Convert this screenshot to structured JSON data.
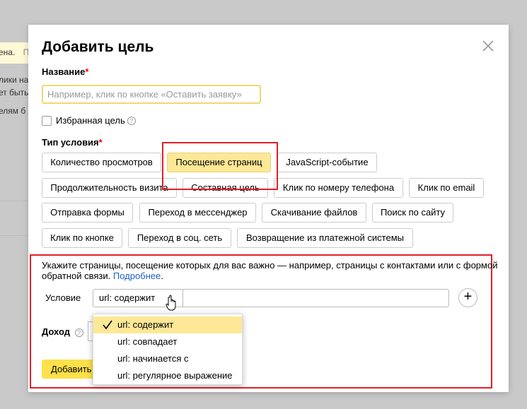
{
  "background": {
    "line1a": "ена.",
    "line1b": "П",
    "line2": "лики на",
    "line3": "ет быть",
    "line4": "елям б"
  },
  "modal": {
    "title": "Добавить цель",
    "name_label": "Название",
    "required_mark": "*",
    "name_placeholder": "Например, клик по кнопке «Оставить заявку»",
    "favorite_label": "Избранная цель",
    "help_symbol": "?",
    "condition_type_label": "Тип условия",
    "condition_types": [
      "Количество просмотров",
      "Посещение страниц",
      "JavaScript-событие",
      "Продолжительность визита",
      "Составная цель",
      "Клик по номеру телефона",
      "Клик по email",
      "Отправка формы",
      "Переход в мессенджер",
      "Скачивание файлов",
      "Поиск по сайту",
      "Клик по кнопке",
      "Переход в соц. сеть",
      "Возвращение из платежной системы"
    ],
    "selected_type": "Посещение страниц",
    "description_text": "Укажите страницы, посещение которых для вас важно — например, страницы с контактами или с формой обратной связи. ",
    "description_link": "Подробнее",
    "description_end": ".",
    "condition_label": "Условие",
    "condition_selected": "url: содержит",
    "condition_value": "",
    "plus_symbol": "+",
    "income_label": "Доход",
    "add_button": "Добавить цель"
  },
  "dropdown": {
    "options": [
      "url: содержит",
      "url: совпадает",
      "url: начинается с",
      "url: регулярное выражение"
    ],
    "selected_index": 0
  },
  "colors": {
    "accent_yellow": "#fde04a",
    "selected_yellow": "#fde897",
    "highlight_red": "#e0202a",
    "link_blue": "#1f5fc4"
  },
  "icons": {
    "close": "close-icon",
    "check": "check-icon",
    "cursor": "hand-cursor-icon"
  }
}
